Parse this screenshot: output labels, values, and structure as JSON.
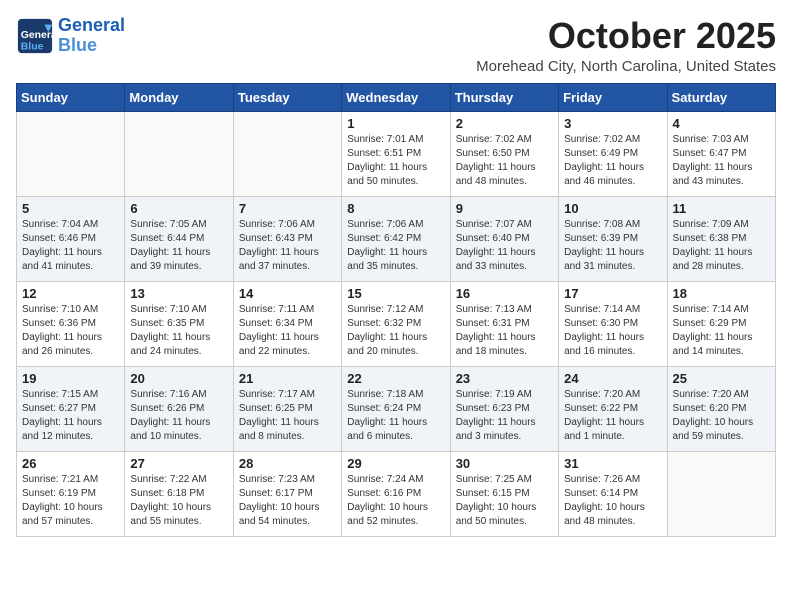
{
  "header": {
    "logo_line1": "General",
    "logo_line2": "Blue",
    "month": "October 2025",
    "location": "Morehead City, North Carolina, United States"
  },
  "weekdays": [
    "Sunday",
    "Monday",
    "Tuesday",
    "Wednesday",
    "Thursday",
    "Friday",
    "Saturday"
  ],
  "weeks": [
    [
      {
        "day": "",
        "info": ""
      },
      {
        "day": "",
        "info": ""
      },
      {
        "day": "",
        "info": ""
      },
      {
        "day": "1",
        "info": "Sunrise: 7:01 AM\nSunset: 6:51 PM\nDaylight: 11 hours\nand 50 minutes."
      },
      {
        "day": "2",
        "info": "Sunrise: 7:02 AM\nSunset: 6:50 PM\nDaylight: 11 hours\nand 48 minutes."
      },
      {
        "day": "3",
        "info": "Sunrise: 7:02 AM\nSunset: 6:49 PM\nDaylight: 11 hours\nand 46 minutes."
      },
      {
        "day": "4",
        "info": "Sunrise: 7:03 AM\nSunset: 6:47 PM\nDaylight: 11 hours\nand 43 minutes."
      }
    ],
    [
      {
        "day": "5",
        "info": "Sunrise: 7:04 AM\nSunset: 6:46 PM\nDaylight: 11 hours\nand 41 minutes."
      },
      {
        "day": "6",
        "info": "Sunrise: 7:05 AM\nSunset: 6:44 PM\nDaylight: 11 hours\nand 39 minutes."
      },
      {
        "day": "7",
        "info": "Sunrise: 7:06 AM\nSunset: 6:43 PM\nDaylight: 11 hours\nand 37 minutes."
      },
      {
        "day": "8",
        "info": "Sunrise: 7:06 AM\nSunset: 6:42 PM\nDaylight: 11 hours\nand 35 minutes."
      },
      {
        "day": "9",
        "info": "Sunrise: 7:07 AM\nSunset: 6:40 PM\nDaylight: 11 hours\nand 33 minutes."
      },
      {
        "day": "10",
        "info": "Sunrise: 7:08 AM\nSunset: 6:39 PM\nDaylight: 11 hours\nand 31 minutes."
      },
      {
        "day": "11",
        "info": "Sunrise: 7:09 AM\nSunset: 6:38 PM\nDaylight: 11 hours\nand 28 minutes."
      }
    ],
    [
      {
        "day": "12",
        "info": "Sunrise: 7:10 AM\nSunset: 6:36 PM\nDaylight: 11 hours\nand 26 minutes."
      },
      {
        "day": "13",
        "info": "Sunrise: 7:10 AM\nSunset: 6:35 PM\nDaylight: 11 hours\nand 24 minutes."
      },
      {
        "day": "14",
        "info": "Sunrise: 7:11 AM\nSunset: 6:34 PM\nDaylight: 11 hours\nand 22 minutes."
      },
      {
        "day": "15",
        "info": "Sunrise: 7:12 AM\nSunset: 6:32 PM\nDaylight: 11 hours\nand 20 minutes."
      },
      {
        "day": "16",
        "info": "Sunrise: 7:13 AM\nSunset: 6:31 PM\nDaylight: 11 hours\nand 18 minutes."
      },
      {
        "day": "17",
        "info": "Sunrise: 7:14 AM\nSunset: 6:30 PM\nDaylight: 11 hours\nand 16 minutes."
      },
      {
        "day": "18",
        "info": "Sunrise: 7:14 AM\nSunset: 6:29 PM\nDaylight: 11 hours\nand 14 minutes."
      }
    ],
    [
      {
        "day": "19",
        "info": "Sunrise: 7:15 AM\nSunset: 6:27 PM\nDaylight: 11 hours\nand 12 minutes."
      },
      {
        "day": "20",
        "info": "Sunrise: 7:16 AM\nSunset: 6:26 PM\nDaylight: 11 hours\nand 10 minutes."
      },
      {
        "day": "21",
        "info": "Sunrise: 7:17 AM\nSunset: 6:25 PM\nDaylight: 11 hours\nand 8 minutes."
      },
      {
        "day": "22",
        "info": "Sunrise: 7:18 AM\nSunset: 6:24 PM\nDaylight: 11 hours\nand 6 minutes."
      },
      {
        "day": "23",
        "info": "Sunrise: 7:19 AM\nSunset: 6:23 PM\nDaylight: 11 hours\nand 3 minutes."
      },
      {
        "day": "24",
        "info": "Sunrise: 7:20 AM\nSunset: 6:22 PM\nDaylight: 11 hours\nand 1 minute."
      },
      {
        "day": "25",
        "info": "Sunrise: 7:20 AM\nSunset: 6:20 PM\nDaylight: 10 hours\nand 59 minutes."
      }
    ],
    [
      {
        "day": "26",
        "info": "Sunrise: 7:21 AM\nSunset: 6:19 PM\nDaylight: 10 hours\nand 57 minutes."
      },
      {
        "day": "27",
        "info": "Sunrise: 7:22 AM\nSunset: 6:18 PM\nDaylight: 10 hours\nand 55 minutes."
      },
      {
        "day": "28",
        "info": "Sunrise: 7:23 AM\nSunset: 6:17 PM\nDaylight: 10 hours\nand 54 minutes."
      },
      {
        "day": "29",
        "info": "Sunrise: 7:24 AM\nSunset: 6:16 PM\nDaylight: 10 hours\nand 52 minutes."
      },
      {
        "day": "30",
        "info": "Sunrise: 7:25 AM\nSunset: 6:15 PM\nDaylight: 10 hours\nand 50 minutes."
      },
      {
        "day": "31",
        "info": "Sunrise: 7:26 AM\nSunset: 6:14 PM\nDaylight: 10 hours\nand 48 minutes."
      },
      {
        "day": "",
        "info": ""
      }
    ]
  ]
}
